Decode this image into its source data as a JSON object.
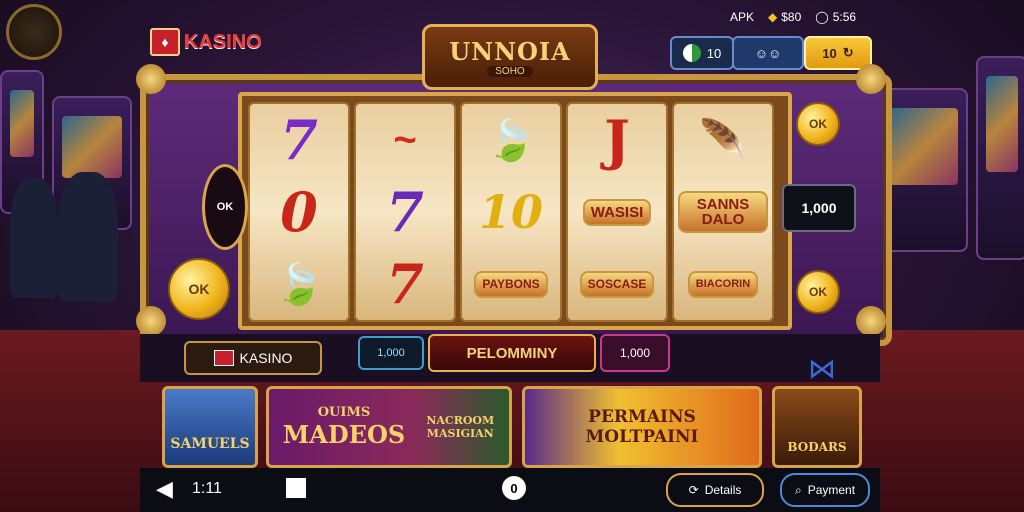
{
  "status_bar": {
    "left_text": "APK",
    "coins": "$80",
    "timer": "5:56"
  },
  "brand": {
    "flag_glyph": "♦",
    "name": "KASINO"
  },
  "header": {
    "title_main": "UNNOIA",
    "title_sub": "SOHO",
    "balance_value": "10",
    "bonus_value": "10"
  },
  "reels": [
    [
      "7",
      "0",
      "🍃"
    ],
    [
      "~",
      "7",
      "7"
    ],
    [
      "🍃",
      "10",
      "PAYBONS"
    ],
    [
      "J",
      "WASISI",
      "SOSCASE"
    ],
    [
      "🪶",
      "SANNS DALO",
      "BIACORIN"
    ]
  ],
  "side": {
    "left_chip": "OK",
    "left_coin": "OK",
    "right_display": "1,000",
    "right_coin_top": "OK",
    "right_coin_bottom": "OK"
  },
  "controls": {
    "casino_label": "KASINO",
    "bet_display": "1,000",
    "spin_label": "PELOMMINY",
    "win_display": "1,000"
  },
  "promos": [
    {
      "label": "SAMUELS"
    },
    {
      "label_1": "OUIMS",
      "label_2": "MADEOS",
      "label_3": "NACROOM MASIGIAN"
    },
    {
      "label_1": "PERMAINS",
      "label_2": "MOLTPAINI"
    },
    {
      "label": "BODARS"
    }
  ],
  "nav": {
    "left_label": "1:11",
    "center_label": "0",
    "btn_1": "Details",
    "btn_2": "Payment"
  },
  "colors": {
    "gold": "#d7a44a",
    "purple": "#3b1752",
    "red": "#c81f2c"
  }
}
